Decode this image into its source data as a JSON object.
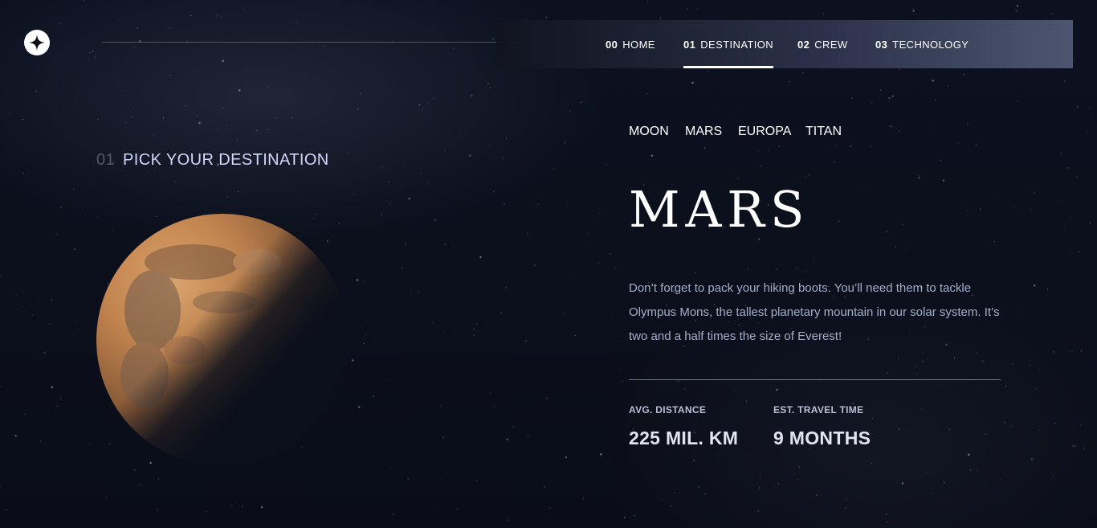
{
  "header": {
    "logo_icon": "star-compass-icon"
  },
  "nav": {
    "items": [
      {
        "num": "00",
        "label": "HOME",
        "active": false
      },
      {
        "num": "01",
        "label": "DESTINATION",
        "active": true
      },
      {
        "num": "02",
        "label": "CREW",
        "active": false
      },
      {
        "num": "03",
        "label": "TECHNOLOGY",
        "active": false
      }
    ]
  },
  "page": {
    "heading_num": "01",
    "heading": "PICK YOUR DESTINATION"
  },
  "tabs": [
    {
      "label": "MOON",
      "active": false
    },
    {
      "label": "MARS",
      "active": true
    },
    {
      "label": "EUROPA",
      "active": false
    },
    {
      "label": "TITAN",
      "active": false
    }
  ],
  "destination": {
    "name": "MARS",
    "description": "Don’t forget to pack your hiking boots. You’ll need them to tackle Olympus Mons, the tallest planetary mountain in our solar system. It’s two and a half times the size of Everest!",
    "stats": [
      {
        "label": "AVG. DISTANCE",
        "value": "225 MIL. KM"
      },
      {
        "label": "EST. TRAVEL TIME",
        "value": "9 MONTHS"
      }
    ]
  },
  "colors": {
    "background": "#0b0f1b",
    "text": "#ffffff",
    "muted": "#d0d6f9",
    "planet": "#c98a52"
  }
}
